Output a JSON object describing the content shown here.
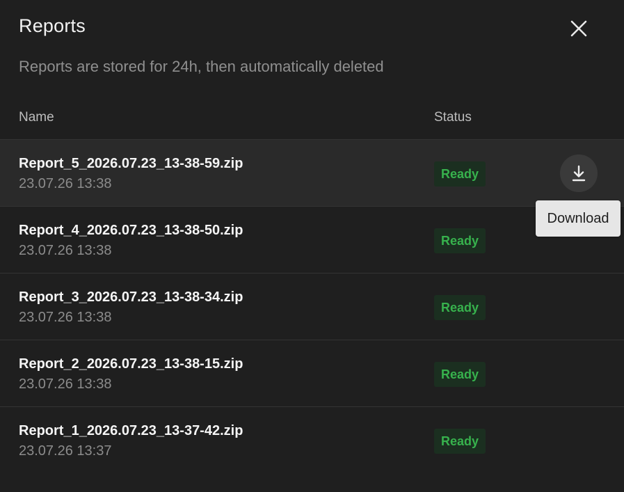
{
  "dialog": {
    "title": "Reports",
    "subtitle": "Reports are stored for 24h, then automatically deleted",
    "close_icon": "close-icon"
  },
  "table": {
    "columns": {
      "name": "Name",
      "status": "Status"
    },
    "rows": [
      {
        "name": "Report_5_2026.07.23_13-38-59.zip",
        "date": "23.07.26 13:38",
        "status": "Ready"
      },
      {
        "name": "Report_4_2026.07.23_13-38-50.zip",
        "date": "23.07.26 13:38",
        "status": "Ready"
      },
      {
        "name": "Report_3_2026.07.23_13-38-34.zip",
        "date": "23.07.26 13:38",
        "status": "Ready"
      },
      {
        "name": "Report_2_2026.07.23_13-38-15.zip",
        "date": "23.07.26 13:38",
        "status": "Ready"
      },
      {
        "name": "Report_1_2026.07.23_13-37-42.zip",
        "date": "23.07.26 13:37",
        "status": "Ready"
      }
    ]
  },
  "download": {
    "icon": "download-icon",
    "tooltip": "Download"
  },
  "colors": {
    "background": "#1f1f1f",
    "status_ready_text": "#37b24d",
    "status_ready_bg": "#1b2f20",
    "tooltip_bg": "#e6e6e6"
  }
}
